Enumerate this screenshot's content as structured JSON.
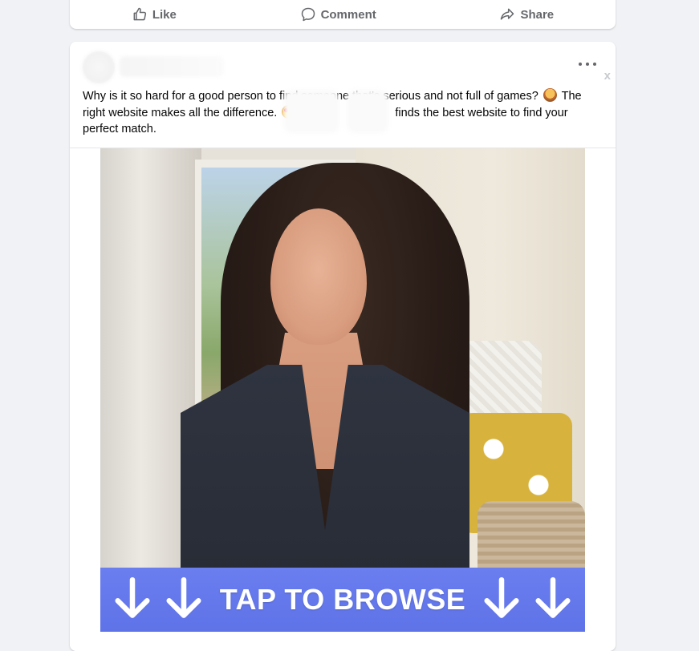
{
  "actions": {
    "like": "Like",
    "comment": "Comment",
    "share": "Share"
  },
  "post": {
    "close_label": "x",
    "text_line1": "Why is it so hard for a good person to find someone that's serious and not full of games?",
    "text_line2a": "The right website makes all the difference.",
    "text_line2b": "finds the best website to find your perfect match.",
    "cta_text": "TAP TO BROWSE"
  },
  "colors": {
    "action_text": "#65676b",
    "cta_background": "#6a7ef0"
  }
}
